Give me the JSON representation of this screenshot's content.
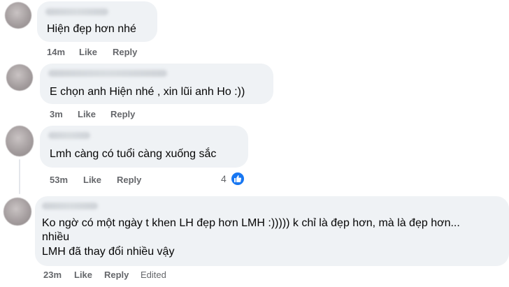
{
  "comments": [
    {
      "text_lines": [
        "Hiện đẹp hơn nhé"
      ],
      "time": "14m",
      "like_label": "Like",
      "reply_label": "Reply"
    },
    {
      "text_lines": [
        "E chọn anh Hiện nhé , xin lũi anh Ho :))"
      ],
      "time": "3m",
      "like_label": "Like",
      "reply_label": "Reply"
    },
    {
      "text_lines": [
        "Lmh càng có tuổi càng xuống sắc"
      ],
      "time": "53m",
      "like_label": "Like",
      "reply_label": "Reply",
      "reaction_count": "4",
      "reaction_icon": "thumbs-up-icon"
    },
    {
      "text_lines": [
        "Ko ngờ có một ngày t khen LH đẹp hơn LMH :))))) k chỉ là đẹp hơn, mà là đẹp hơn...",
        "nhiều",
        "LMH đã thay đổi nhiều vậy"
      ],
      "time": "23m",
      "like_label": "Like",
      "reply_label": "Reply",
      "edited_label": "Edited"
    }
  ],
  "colors": {
    "bubble": "#eff2f5",
    "meta_text": "#65676b",
    "comment_text": "#050505",
    "like_badge": "#1877f2"
  }
}
